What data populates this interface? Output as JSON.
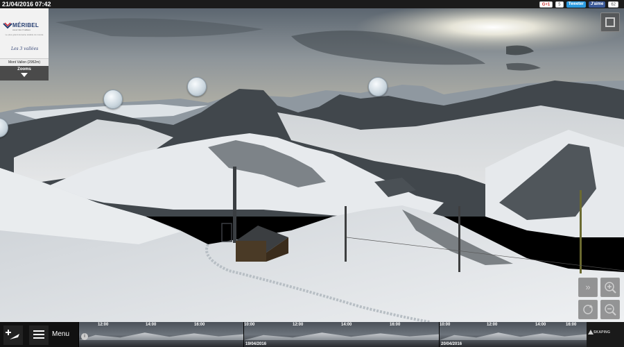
{
  "header": {
    "datetime": "21/04/2016 07:42"
  },
  "social": {
    "gplus_label": "G+1",
    "gplus_count": "5",
    "twitter_label": "Tweeter",
    "facebook_label": "J'aime",
    "facebook_count": "62"
  },
  "branding": {
    "resort_name": "MÉRIBEL",
    "tagline": "coeur des 3 vallées",
    "domain_tagline": "Le plus grand domaine skiable du monde",
    "area_logo_text": "Les 3 vallées"
  },
  "camera": {
    "location_label": "Mont Vallon (2952m)",
    "zooms_label": "Zooms"
  },
  "icons": {
    "fullscreen": "fullscreen-icon",
    "fast_forward": "fast-forward-icon",
    "zoom_in": "zoom-in-icon",
    "zoom_out": "zoom-out-icon",
    "rotate": "rotate-icon",
    "add_bookmark": "plus-plane-icon",
    "menu": "hamburger-icon",
    "info": "info-icon",
    "zoom_bubble": "magnifier-bubble-icon"
  },
  "bottom": {
    "menu_label": "Menu",
    "provider": "SKAPING"
  },
  "timeline": {
    "time_labels": [
      "12:00",
      "14:00",
      "16:00",
      "10:00",
      "12:00",
      "14:00",
      "16:00",
      "10:00",
      "12:00",
      "14:00",
      "16:00"
    ],
    "date_labels": [
      "19/04/2016",
      "20/04/2016"
    ]
  },
  "colors": {
    "topbar_bg": "#1b1b1b",
    "twitter": "#2b9ae0",
    "facebook": "#3b5998",
    "brand_blue": "#233c6f",
    "brand_red": "#d0202e"
  }
}
